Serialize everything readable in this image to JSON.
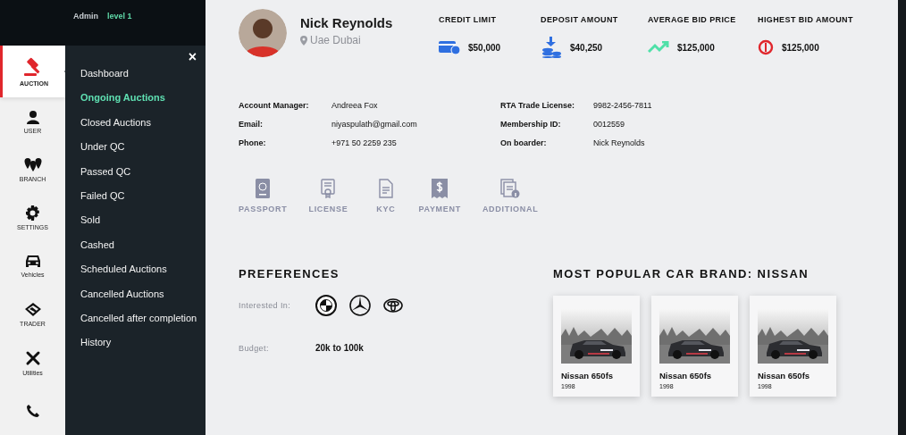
{
  "header": {
    "role": "Admin",
    "level": "level 1"
  },
  "nav": [
    {
      "label": "AUCTION",
      "selected": true
    },
    {
      "label": "USER",
      "selected": false
    },
    {
      "label": "BRANCH",
      "selected": false
    },
    {
      "label": "SETTINGS",
      "selected": false
    },
    {
      "label": "Vehicles",
      "selected": false
    },
    {
      "label": "TRADER",
      "selected": false
    },
    {
      "label": "Utilities",
      "selected": false
    },
    {
      "selected": false
    }
  ],
  "submenu": {
    "close": "×",
    "items": [
      {
        "label": "Dashboard",
        "selected": false
      },
      {
        "label": "Ongoing Auctions",
        "selected": true
      },
      {
        "label": "Closed Auctions",
        "selected": false
      },
      {
        "label": "Under QC",
        "selected": false
      },
      {
        "label": "Passed QC",
        "selected": false
      },
      {
        "label": "Failed QC",
        "selected": false
      },
      {
        "label": "Sold",
        "selected": false
      },
      {
        "label": "Cashed",
        "selected": false
      },
      {
        "label": "Scheduled Auctions",
        "selected": false
      },
      {
        "label": "Cancelled Auctions",
        "selected": false
      },
      {
        "label": "Cancelled after completion",
        "selected": false
      },
      {
        "label": "History",
        "selected": false
      }
    ]
  },
  "profile": {
    "name": "Nick Reynolds",
    "location": "Uae Dubai"
  },
  "stats": [
    {
      "label": "CREDIT LIMIT",
      "value": "$50,000"
    },
    {
      "label": "DEPOSIT AMOUNT",
      "value": "$40,250"
    },
    {
      "label": "AVERAGE BID PRICE",
      "value": "$125,000"
    },
    {
      "label": "HIGHEST BID AMOUNT",
      "value": "$125,000"
    }
  ],
  "details": [
    {
      "label": "Account Manager:",
      "value": "Andreea Fox"
    },
    {
      "label": "RTA Trade License:",
      "value": "9982-2456-7811"
    },
    {
      "label": "Email:",
      "value": "niyaspulath@gmail.com"
    },
    {
      "label": "Membership ID:",
      "value": "0012559"
    },
    {
      "label": "Phone:",
      "value": "+971 50 2259 235"
    },
    {
      "label": "On boarder:",
      "value": "Nick Reynolds"
    }
  ],
  "documents": [
    "PASSPORT",
    "LICENSE",
    "KYC",
    "PAYMENT",
    "ADDITIONAL"
  ],
  "preferences": {
    "title": "PREFERENCES",
    "interested_label": "Interested In:",
    "budget_label": "Budget:",
    "budget": "20k to 100k"
  },
  "popular": {
    "title": "MOST POPULAR CAR BRAND: NISSAN",
    "cars": [
      {
        "name": "Nissan 650fs",
        "year": "1998"
      },
      {
        "name": "Nissan 650fs",
        "year": "1998"
      },
      {
        "name": "Nissan 650fs",
        "year": "1998"
      }
    ]
  }
}
